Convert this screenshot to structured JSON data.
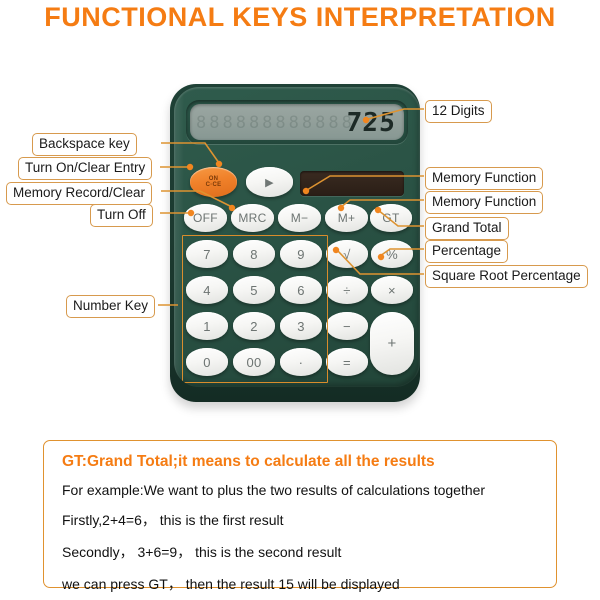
{
  "page": {
    "title": "FUNCTIONAL KEYS INTERPRETATION",
    "accent_color": "#f57c13",
    "label_border_color": "#d79a4e",
    "body_color": "#2b5446"
  },
  "calculator": {
    "display": {
      "value": "725",
      "ghost_segments": "888888888888",
      "digit_capacity": "12 Digits"
    },
    "solar_panel": "solar-panel",
    "keys": {
      "on_clear": "ON\\nC·CE",
      "backspace": "▶",
      "off": "OFF",
      "mrc": "MRC",
      "m_minus": "M−",
      "m_plus": "M+",
      "gt": "GT",
      "sqrt": "√",
      "percent": "%",
      "divide": "÷",
      "multiply": "×",
      "minus": "−",
      "plus": "+",
      "equals": "=",
      "seven": "7",
      "eight": "8",
      "nine": "9",
      "four": "4",
      "five": "5",
      "six": "6",
      "one": "1",
      "two": "2",
      "three": "3",
      "zero": "0",
      "double_zero": "00",
      "dot": "·"
    }
  },
  "callouts": {
    "left": [
      {
        "id": "backspace-key",
        "text": "Backspace key"
      },
      {
        "id": "turn-on-clear-entry",
        "text": "Turn On/Clear Entry"
      },
      {
        "id": "memory-record-clear",
        "text": "Memory Record/Clear"
      },
      {
        "id": "turn-off",
        "text": "Turn Off"
      },
      {
        "id": "number-key",
        "text": "Number Key"
      }
    ],
    "right": [
      {
        "id": "twelve-digits",
        "text": "12 Digits"
      },
      {
        "id": "memory-function-1",
        "text": "Memory Function"
      },
      {
        "id": "memory-function-2",
        "text": "Memory Function"
      },
      {
        "id": "grand-total",
        "text": "Grand Total"
      },
      {
        "id": "percentage",
        "text": "Percentage"
      },
      {
        "id": "square-root-percentage",
        "text": "Square Root Percentage"
      }
    ]
  },
  "note": {
    "title": "GT:Grand Total;it means to calculate all the results",
    "lines": [
      "For example:We want to plus the two  results of calculations together",
      "Firstly,2+4=6， this is the first result",
      "Secondly， 3+6=9， this is the second result",
      "we can press GT， then the result 15 will be displayed"
    ]
  }
}
